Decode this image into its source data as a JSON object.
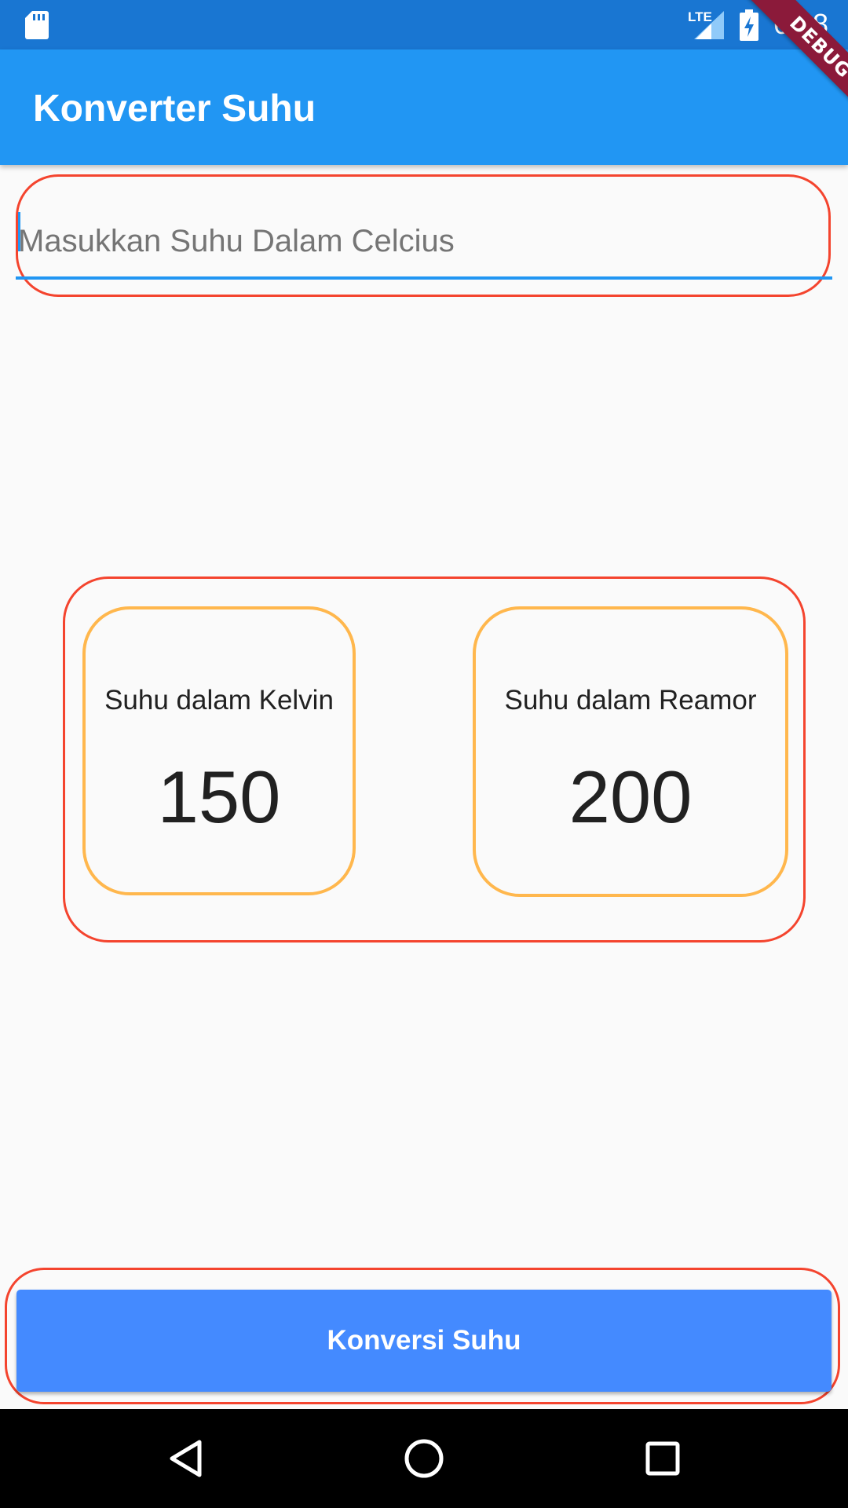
{
  "status_bar": {
    "network_type": "LTE",
    "time": "6:18",
    "icons": [
      "sd-card-icon",
      "signal-icon",
      "battery-charging-icon"
    ]
  },
  "debug_banner": {
    "label": "DEBUG",
    "color": "#8b1a3a"
  },
  "app_bar": {
    "title": "Konverter Suhu",
    "color": "#2196f3"
  },
  "input": {
    "placeholder": "Masukkan Suhu Dalam Celcius",
    "value": ""
  },
  "results": {
    "kelvin": {
      "label": "Suhu dalam Kelvin",
      "value": "150"
    },
    "reamor": {
      "label": "Suhu dalam Reamor",
      "value": "200"
    }
  },
  "button": {
    "label": "Konversi Suhu",
    "color": "#448aff"
  },
  "nav_bar": {
    "icons": [
      "back-icon",
      "home-icon",
      "recents-icon"
    ]
  },
  "colors": {
    "highlight_outline": "#f4442e",
    "card_outline": "#ffb74d"
  }
}
